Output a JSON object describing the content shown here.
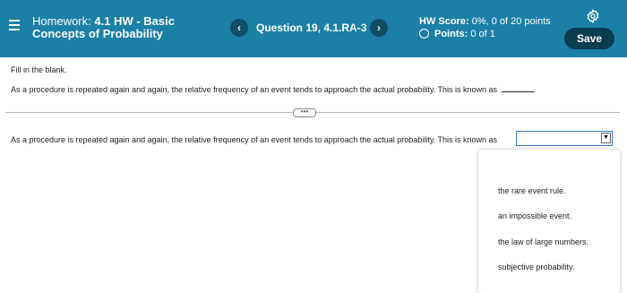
{
  "header": {
    "title_prefix": "Homework:",
    "title_bold_line1": "4.1 HW - Basic",
    "title_bold_line2": "Concepts of Probability",
    "question_label": "Question 19, 4.1.RA-3",
    "prev_symbol": "‹",
    "next_symbol": "›",
    "hw_score_label": "HW Score:",
    "hw_score_value": "0%, 0 of 20 points",
    "points_label": "Points:",
    "points_value": "0 of 1",
    "save_label": "Save",
    "colors": {
      "header_bg": "#1b7fa6",
      "save_bg": "#0a3c52",
      "nav_bg": "#0d4e66"
    }
  },
  "content": {
    "instruction": "Fill in the blank.",
    "question": "As a procedure is repeated again and again, the relative frequency of an event tends to approach the actual probability. This is known as",
    "question_suffix": ".",
    "expander_label": "•••",
    "answer_prompt": "As a procedure is repeated again and again, the relative frequency of an event tends to approach the actual probability. This is known as",
    "dropdown_arrow": "▼",
    "options": [
      "the rare event rule.",
      "an impossible event.",
      "the law of large numbers.",
      "subjective probability."
    ]
  }
}
